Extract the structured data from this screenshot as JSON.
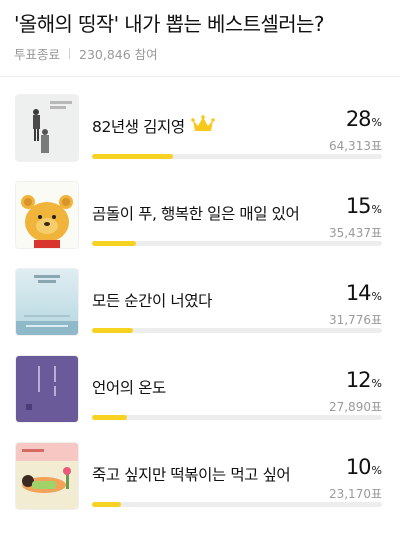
{
  "poll": {
    "title": "'올해의 띵작' 내가 뽑는 베스트셀러는?",
    "status": "투표종료",
    "participants": "230,846 참여"
  },
  "accent_color": "#f8d222",
  "options": [
    {
      "title": "82년생 김지영",
      "percent": 28,
      "unit": "%",
      "votes": "64,313표",
      "winner": true,
      "cover": "82-nyeonsaeng-cover"
    },
    {
      "title": "곰돌이 푸, 행복한 일은 매일 있어",
      "percent": 15,
      "unit": "%",
      "votes": "35,437표",
      "winner": false,
      "cover": "pooh-cover"
    },
    {
      "title": "모든 순간이 너였다",
      "percent": 14,
      "unit": "%",
      "votes": "31,776표",
      "winner": false,
      "cover": "every-moment-cover"
    },
    {
      "title": "언어의 온도",
      "percent": 12,
      "unit": "%",
      "votes": "27,890표",
      "winner": false,
      "cover": "language-temperature-cover"
    },
    {
      "title": "죽고 싶지만 떡볶이는 먹고 싶어",
      "percent": 10,
      "unit": "%",
      "votes": "23,170표",
      "winner": false,
      "cover": "tteokbokki-cover"
    }
  ],
  "icons": {
    "crown": "crown-icon"
  }
}
